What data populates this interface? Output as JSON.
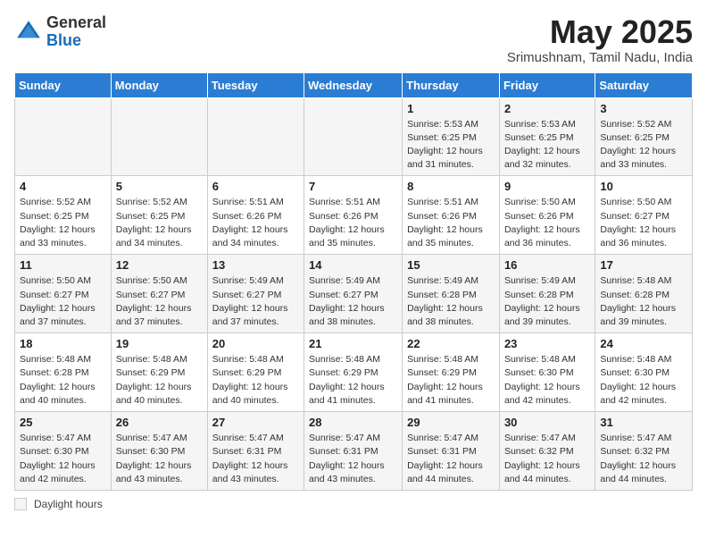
{
  "header": {
    "logo_general": "General",
    "logo_blue": "Blue",
    "month_title": "May 2025",
    "location": "Srimushnam, Tamil Nadu, India"
  },
  "weekdays": [
    "Sunday",
    "Monday",
    "Tuesday",
    "Wednesday",
    "Thursday",
    "Friday",
    "Saturday"
  ],
  "footer_label": "Daylight hours",
  "weeks": [
    [
      {
        "day": "",
        "info": ""
      },
      {
        "day": "",
        "info": ""
      },
      {
        "day": "",
        "info": ""
      },
      {
        "day": "",
        "info": ""
      },
      {
        "day": "1",
        "info": "Sunrise: 5:53 AM\nSunset: 6:25 PM\nDaylight: 12 hours\nand 31 minutes."
      },
      {
        "day": "2",
        "info": "Sunrise: 5:53 AM\nSunset: 6:25 PM\nDaylight: 12 hours\nand 32 minutes."
      },
      {
        "day": "3",
        "info": "Sunrise: 5:52 AM\nSunset: 6:25 PM\nDaylight: 12 hours\nand 33 minutes."
      }
    ],
    [
      {
        "day": "4",
        "info": "Sunrise: 5:52 AM\nSunset: 6:25 PM\nDaylight: 12 hours\nand 33 minutes."
      },
      {
        "day": "5",
        "info": "Sunrise: 5:52 AM\nSunset: 6:25 PM\nDaylight: 12 hours\nand 34 minutes."
      },
      {
        "day": "6",
        "info": "Sunrise: 5:51 AM\nSunset: 6:26 PM\nDaylight: 12 hours\nand 34 minutes."
      },
      {
        "day": "7",
        "info": "Sunrise: 5:51 AM\nSunset: 6:26 PM\nDaylight: 12 hours\nand 35 minutes."
      },
      {
        "day": "8",
        "info": "Sunrise: 5:51 AM\nSunset: 6:26 PM\nDaylight: 12 hours\nand 35 minutes."
      },
      {
        "day": "9",
        "info": "Sunrise: 5:50 AM\nSunset: 6:26 PM\nDaylight: 12 hours\nand 36 minutes."
      },
      {
        "day": "10",
        "info": "Sunrise: 5:50 AM\nSunset: 6:27 PM\nDaylight: 12 hours\nand 36 minutes."
      }
    ],
    [
      {
        "day": "11",
        "info": "Sunrise: 5:50 AM\nSunset: 6:27 PM\nDaylight: 12 hours\nand 37 minutes."
      },
      {
        "day": "12",
        "info": "Sunrise: 5:50 AM\nSunset: 6:27 PM\nDaylight: 12 hours\nand 37 minutes."
      },
      {
        "day": "13",
        "info": "Sunrise: 5:49 AM\nSunset: 6:27 PM\nDaylight: 12 hours\nand 37 minutes."
      },
      {
        "day": "14",
        "info": "Sunrise: 5:49 AM\nSunset: 6:27 PM\nDaylight: 12 hours\nand 38 minutes."
      },
      {
        "day": "15",
        "info": "Sunrise: 5:49 AM\nSunset: 6:28 PM\nDaylight: 12 hours\nand 38 minutes."
      },
      {
        "day": "16",
        "info": "Sunrise: 5:49 AM\nSunset: 6:28 PM\nDaylight: 12 hours\nand 39 minutes."
      },
      {
        "day": "17",
        "info": "Sunrise: 5:48 AM\nSunset: 6:28 PM\nDaylight: 12 hours\nand 39 minutes."
      }
    ],
    [
      {
        "day": "18",
        "info": "Sunrise: 5:48 AM\nSunset: 6:28 PM\nDaylight: 12 hours\nand 40 minutes."
      },
      {
        "day": "19",
        "info": "Sunrise: 5:48 AM\nSunset: 6:29 PM\nDaylight: 12 hours\nand 40 minutes."
      },
      {
        "day": "20",
        "info": "Sunrise: 5:48 AM\nSunset: 6:29 PM\nDaylight: 12 hours\nand 40 minutes."
      },
      {
        "day": "21",
        "info": "Sunrise: 5:48 AM\nSunset: 6:29 PM\nDaylight: 12 hours\nand 41 minutes."
      },
      {
        "day": "22",
        "info": "Sunrise: 5:48 AM\nSunset: 6:29 PM\nDaylight: 12 hours\nand 41 minutes."
      },
      {
        "day": "23",
        "info": "Sunrise: 5:48 AM\nSunset: 6:30 PM\nDaylight: 12 hours\nand 42 minutes."
      },
      {
        "day": "24",
        "info": "Sunrise: 5:48 AM\nSunset: 6:30 PM\nDaylight: 12 hours\nand 42 minutes."
      }
    ],
    [
      {
        "day": "25",
        "info": "Sunrise: 5:47 AM\nSunset: 6:30 PM\nDaylight: 12 hours\nand 42 minutes."
      },
      {
        "day": "26",
        "info": "Sunrise: 5:47 AM\nSunset: 6:30 PM\nDaylight: 12 hours\nand 43 minutes."
      },
      {
        "day": "27",
        "info": "Sunrise: 5:47 AM\nSunset: 6:31 PM\nDaylight: 12 hours\nand 43 minutes."
      },
      {
        "day": "28",
        "info": "Sunrise: 5:47 AM\nSunset: 6:31 PM\nDaylight: 12 hours\nand 43 minutes."
      },
      {
        "day": "29",
        "info": "Sunrise: 5:47 AM\nSunset: 6:31 PM\nDaylight: 12 hours\nand 44 minutes."
      },
      {
        "day": "30",
        "info": "Sunrise: 5:47 AM\nSunset: 6:32 PM\nDaylight: 12 hours\nand 44 minutes."
      },
      {
        "day": "31",
        "info": "Sunrise: 5:47 AM\nSunset: 6:32 PM\nDaylight: 12 hours\nand 44 minutes."
      }
    ]
  ]
}
